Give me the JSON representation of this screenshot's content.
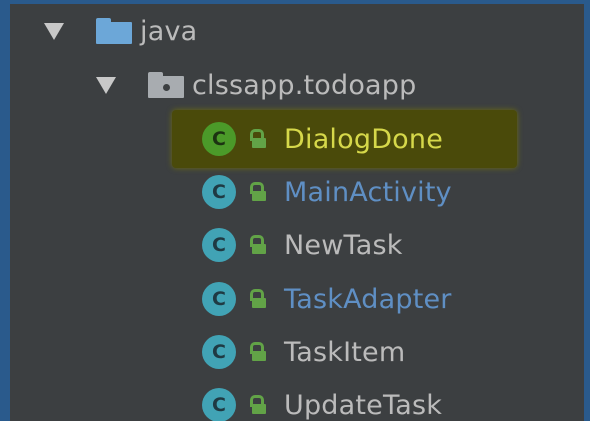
{
  "project_tree": {
    "java_folder": {
      "label": "java",
      "icon": "folder-icon",
      "expanded": true
    },
    "package": {
      "label": "clssapp.todoapp",
      "icon": "package-icon",
      "expanded": true
    },
    "classes": [
      {
        "name": "DialogDone",
        "icon": "class-icon",
        "highlighted": true,
        "text_color": "#d6d84a"
      },
      {
        "name": "MainActivity",
        "icon": "class-icon",
        "highlighted": false,
        "text_color": "#5f8fc4"
      },
      {
        "name": "NewTask",
        "icon": "class-icon",
        "highlighted": false,
        "text_color": "#bbbbbb"
      },
      {
        "name": "TaskAdapter",
        "icon": "class-icon",
        "highlighted": false,
        "text_color": "#5f8fc4"
      },
      {
        "name": "TaskItem",
        "icon": "class-icon",
        "highlighted": false,
        "text_color": "#bbbbbb"
      },
      {
        "name": "UpdateTask",
        "icon": "class-icon",
        "highlighted": false,
        "text_color": "#bbbbbb"
      }
    ],
    "class_icon_letter": "C"
  },
  "colors": {
    "background": "#3c3f41",
    "frame": "#2a5a8c",
    "highlight": "#4a4a0a",
    "class_icon": "#41a3b5",
    "class_icon_active": "#4b9a29",
    "lock_icon": "#62a347"
  }
}
